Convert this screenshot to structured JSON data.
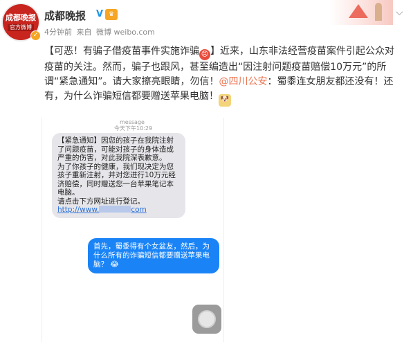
{
  "account": {
    "avatar_line1": "成都晚报",
    "avatar_line2": "官方微博",
    "name": "成都晚报",
    "vip_badge": "V",
    "time": "4分钟前",
    "source_prefix": "来自",
    "source": "微博 weibo.com"
  },
  "post": {
    "part1": "【可恶！有骗子借疫苗事件实施诈骗",
    "part2": "】近来，山东非法经营疫苗案件引起公众对疫苗的关注。然而，骗子也跟风，甚至编造出“因注射问题疫苗赔偿10万元”的所谓“紧急通知”。请大家擦亮眼睛，勿信！",
    "mention": "@四川公安",
    "part3": "：蜀黍连女朋友都还没有！还有，为什么诈骗短信都要赠送苹果电脑！"
  },
  "screenshot": {
    "header_label": "message",
    "timestamp": "今天下午10:29",
    "incoming_text": "【紧急通知】因您的孩子在我院注射了问题疫苗，可能对孩子的身体造成严重的伤害，对此我院深表歉意。\n为了你孩子的健康，我们现决定为您孩子重新注射，并对您进行10万元经济赔偿，同时赠送您一台苹果笔记本电脑。\n请点击下方网址进行登记。",
    "link_prefix": "http://www.",
    "link_suffix": "com",
    "outgoing_text": "首先，蜀黍得有个女盆友，然后，为什么所有的诈骗短信都要赠送苹果电脑？"
  },
  "colors": {
    "brand_red": "#c8251f",
    "mention": "#eb7350",
    "imessage_blue": "#1a84f7"
  },
  "icons": [
    "verified-icon",
    "vip-icon",
    "angry-emoji-icon",
    "doge-emoji-icon",
    "chevron-down-icon",
    "home-button-icon"
  ]
}
